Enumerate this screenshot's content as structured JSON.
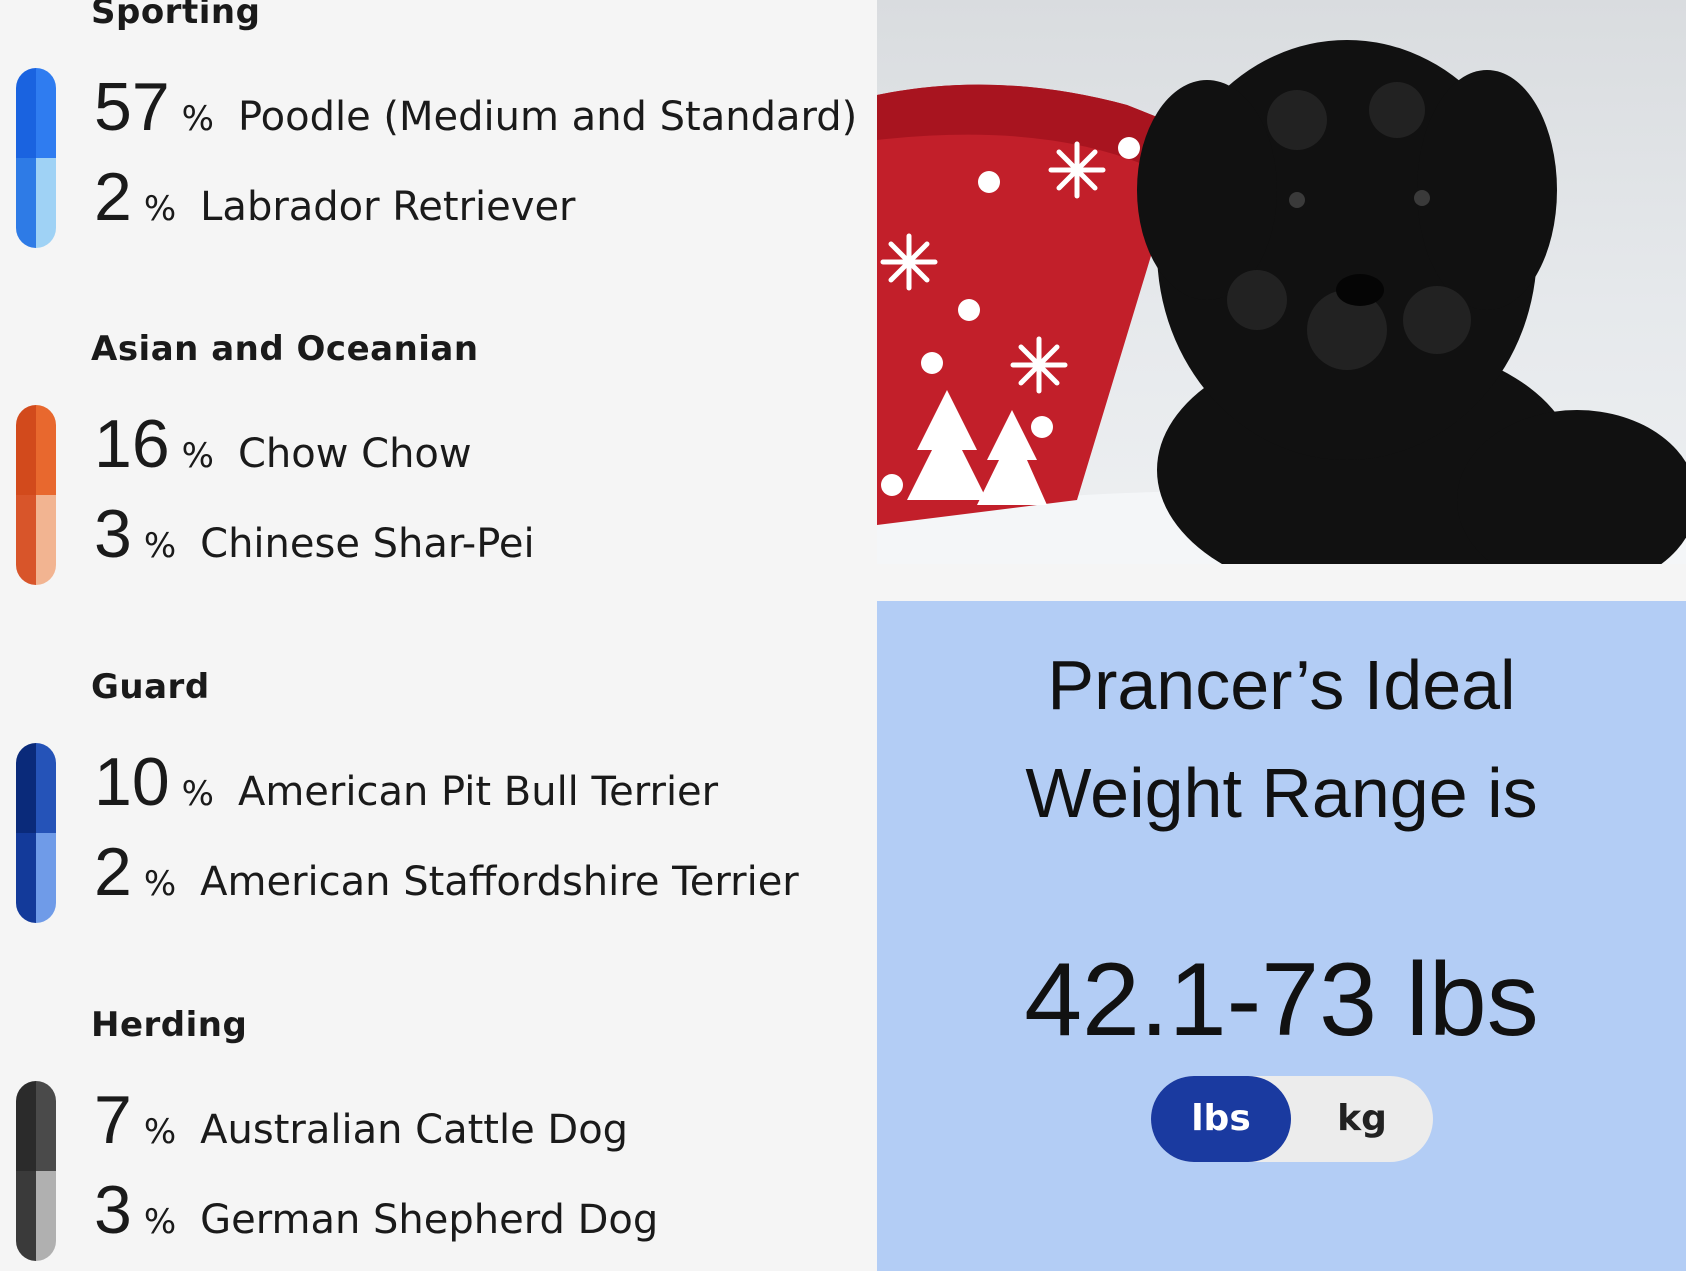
{
  "groups": [
    {
      "title": "Sporting",
      "colors": {
        "dark_top": "#1a63e0",
        "light_top": "#2f7cf0",
        "dark_bottom": "#2e7be6",
        "light_bottom": "#9fd2f5"
      },
      "breeds": [
        {
          "pct": "57",
          "sign": "%",
          "name": "Poodle (Medium and Standard)"
        },
        {
          "pct": "2",
          "sign": "%",
          "name": "Labrador Retriever"
        }
      ]
    },
    {
      "title": "Asian and Oceanian",
      "colors": {
        "dark_top": "#d24a1c",
        "light_top": "#e8682e",
        "dark_bottom": "#d8552a",
        "light_bottom": "#f2b491"
      },
      "breeds": [
        {
          "pct": "16",
          "sign": "%",
          "name": "Chow Chow"
        },
        {
          "pct": "3",
          "sign": "%",
          "name": "Chinese Shar-Pei"
        }
      ]
    },
    {
      "title": "Guard",
      "colors": {
        "dark_top": "#0a2a7a",
        "light_top": "#2553b8",
        "dark_bottom": "#133a9a",
        "light_bottom": "#6f9be8"
      },
      "breeds": [
        {
          "pct": "10",
          "sign": "%",
          "name": "American Pit Bull Terrier"
        },
        {
          "pct": "2",
          "sign": "%",
          "name": "American Staffordshire Terrier"
        }
      ]
    },
    {
      "title": "Herding",
      "colors": {
        "dark_top": "#2b2b2b",
        "light_top": "#4a4a4a",
        "dark_bottom": "#3a3a3a",
        "light_bottom": "#b0b0b0"
      },
      "breeds": [
        {
          "pct": "7",
          "sign": "%",
          "name": "Australian Cattle Dog"
        },
        {
          "pct": "3",
          "sign": "%",
          "name": "German Shepherd Dog"
        }
      ]
    }
  ],
  "weight_card": {
    "title_line1": "Prancer’s Ideal",
    "title_line2": "Weight Range is",
    "range": "42.1-73 lbs",
    "unit_options": [
      "lbs",
      "kg"
    ],
    "selected_unit": "lbs",
    "background": "#b3cdf5",
    "accent": "#1a3aa0"
  },
  "photo": {
    "icon": "puppy-photo"
  }
}
